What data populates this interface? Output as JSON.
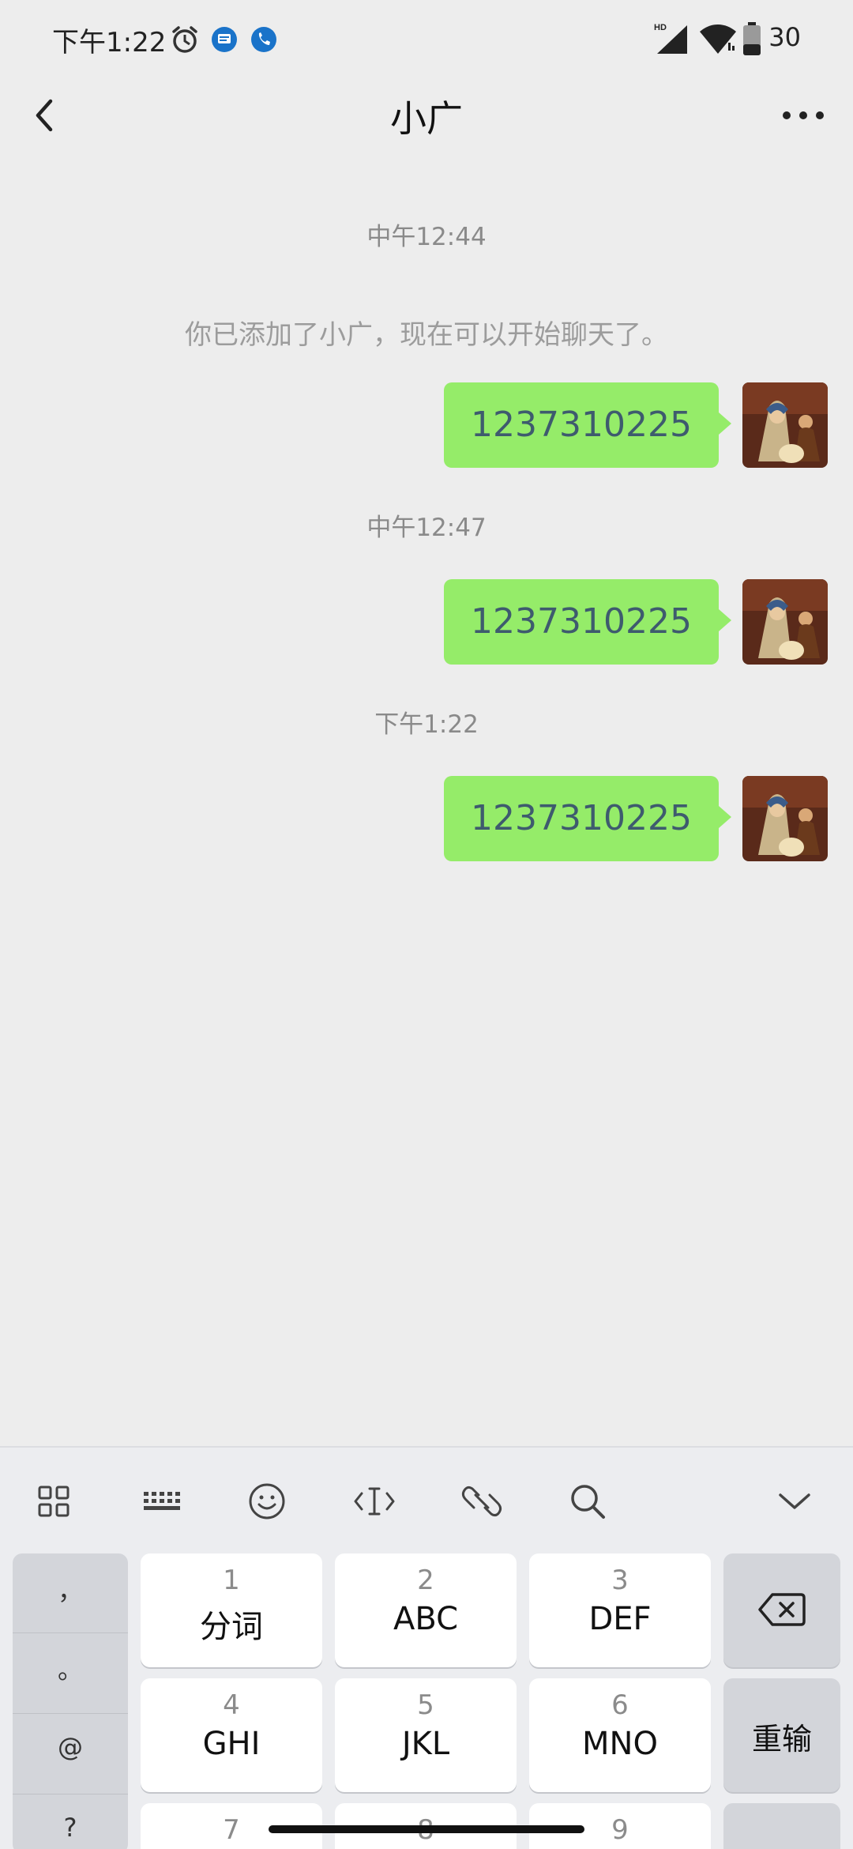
{
  "status_bar": {
    "time": "下午1:22",
    "battery": "30"
  },
  "nav": {
    "title": "小广"
  },
  "chat": {
    "system_message": "你已添加了小广，现在可以开始聊天了。",
    "groups": [
      {
        "timestamp": "中午12:44",
        "message": "1237310225"
      },
      {
        "timestamp": "中午12:47",
        "message": "1237310225"
      },
      {
        "timestamp": "下午1:22",
        "message": "1237310225"
      }
    ]
  },
  "keyboard": {
    "symbols": [
      "，",
      "。",
      "@",
      "?"
    ],
    "keys": [
      {
        "num": "1",
        "letters": "分词"
      },
      {
        "num": "2",
        "letters": "ABC"
      },
      {
        "num": "3",
        "letters": "DEF"
      },
      {
        "num": "4",
        "letters": "GHI"
      },
      {
        "num": "5",
        "letters": "JKL"
      },
      {
        "num": "6",
        "letters": "MNO"
      },
      {
        "num": "7",
        "letters": ""
      },
      {
        "num": "8",
        "letters": ""
      },
      {
        "num": "9",
        "letters": ""
      }
    ],
    "reinput_label": "重输",
    "toolbar_icons": [
      "grid-icon",
      "keyboard-icon",
      "emoji-icon",
      "cursor-icon",
      "link-icon",
      "search-icon",
      "collapse-icon"
    ]
  }
}
